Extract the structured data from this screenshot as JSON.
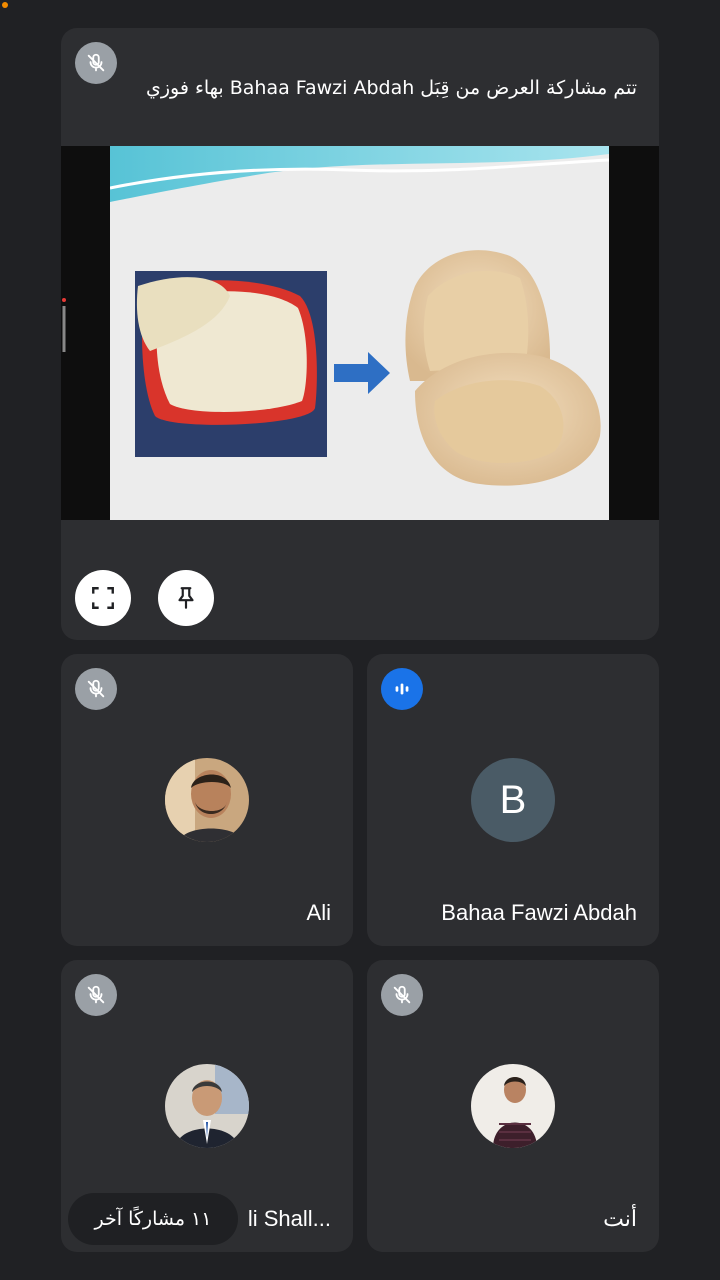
{
  "presentation": {
    "caption": "تتم مشاركة العرض من قِبَل Bahaa Fawzi Abdah بهاء فوزي",
    "fullscreen_icon": "fullscreen-icon",
    "pin_icon": "pin-icon",
    "muted_icon": "mic-off-icon"
  },
  "participants": [
    {
      "name": "Ali",
      "avatar": "photo",
      "muted": true
    },
    {
      "name": "Bahaa Fawzi Abdah",
      "avatar_letter": "B",
      "speaking": true
    },
    {
      "name": "Ali Shall...",
      "name_visible": "li Shall...",
      "avatar": "photo",
      "muted": true
    },
    {
      "name": "أنت",
      "avatar": "photo",
      "muted": true
    }
  ],
  "others_chip": "١١ مشاركًا آخر",
  "colors": {
    "background": "#202124",
    "tile": "#2d2e31",
    "accent_blue": "#1a73e8",
    "status_dot": "#f28b00"
  }
}
